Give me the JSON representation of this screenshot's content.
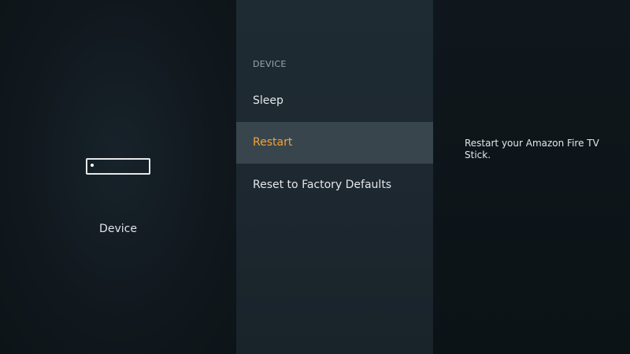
{
  "left_panel": {
    "icon": "fire-tv-stick-icon",
    "label": "Device"
  },
  "menu": {
    "heading": "DEVICE",
    "items": [
      {
        "label": "Sleep",
        "selected": false
      },
      {
        "label": "Restart",
        "selected": true
      },
      {
        "label": "Reset to Factory Defaults",
        "selected": false
      }
    ]
  },
  "description": {
    "text": "Restart your Amazon Fire TV Stick."
  },
  "colors": {
    "selected_text": "#f0a43a",
    "selected_bg": "#39454d",
    "menu_bg": "#1f2b33",
    "background": "#0d1419"
  }
}
